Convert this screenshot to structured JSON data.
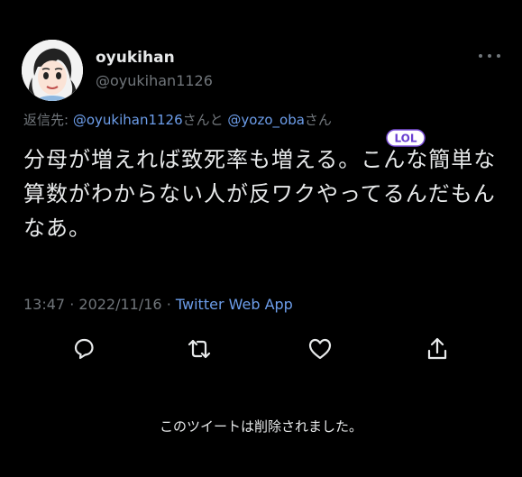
{
  "author": {
    "display_name": "oyukihan",
    "handle": "@oyukihan1126"
  },
  "reply": {
    "prefix": "返信先: ",
    "mention1": "@oyukihan1126",
    "connector": "さんと",
    "mention2": "@yozo_oba",
    "suffix": "さん"
  },
  "tweet": {
    "text": "分母が増えれば致死率も増える。こんな簡単な算数がわからない人が反ワクやってるんだもんなあ。",
    "sticker_text": "LOL"
  },
  "meta": {
    "time": "13:47",
    "date": "2022/11/16",
    "separator": "·",
    "source": "Twitter Web App"
  },
  "actions": {
    "reply_icon": "reply-icon",
    "retweet_icon": "retweet-icon",
    "like_icon": "heart-icon",
    "share_icon": "share-icon"
  },
  "notice": {
    "deleted_text": "このツイートは削除されました。"
  },
  "colors": {
    "background": "#000000",
    "text": "#e7e9ea",
    "muted": "#71767b",
    "link": "#6d9eeb"
  }
}
